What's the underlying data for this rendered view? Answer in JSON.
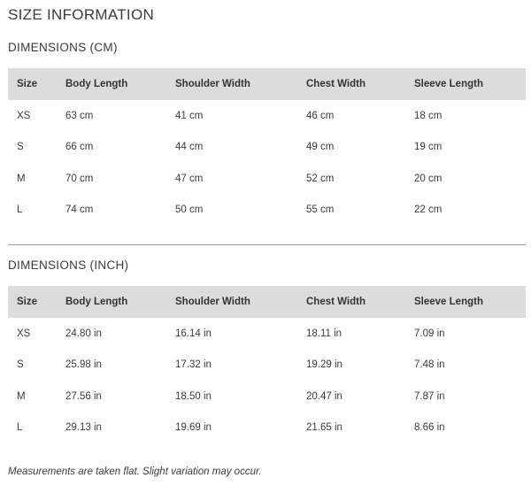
{
  "title": "SIZE INFORMATION",
  "cm_section": {
    "heading": "DIMENSIONS (CM)",
    "headers": [
      "Size",
      "Body Length",
      "Shoulder Width",
      "Chest Width",
      "Sleeve Length"
    ],
    "rows": [
      [
        "XS",
        "63 cm",
        "41 cm",
        "46 cm",
        "18 cm"
      ],
      [
        "S",
        "66 cm",
        "44 cm",
        "49 cm",
        "19 cm"
      ],
      [
        "M",
        "70 cm",
        "47 cm",
        "52 cm",
        "20 cm"
      ],
      [
        "L",
        "74 cm",
        "50 cm",
        "55 cm",
        "22 cm"
      ]
    ]
  },
  "inch_section": {
    "heading": "DIMENSIONS (INCH)",
    "headers": [
      "Size",
      "Body Length",
      "Shoulder Width",
      "Chest Width",
      "Sleeve Length"
    ],
    "rows": [
      [
        "XS",
        "24.80 in",
        "16.14 in",
        "18.11 in",
        "7.09 in"
      ],
      [
        "S",
        "25.98 in",
        "17.32 in",
        "19.29 in",
        "7.48 in"
      ],
      [
        "M",
        "27.56 in",
        "18.50 in",
        "20.47 in",
        "7.87 in"
      ],
      [
        "L",
        "29.13 in",
        "19.69 in",
        "21.65 in",
        "8.66 in"
      ]
    ]
  },
  "note": "Measurements are taken flat. Slight variation may occur."
}
